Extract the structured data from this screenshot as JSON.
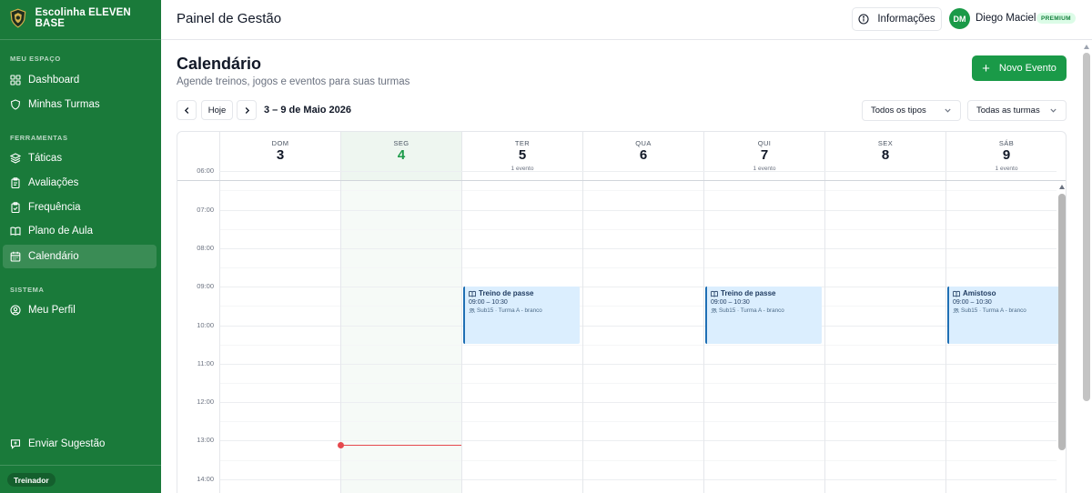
{
  "app": {
    "name": "Escolinha ELEVEN BASE"
  },
  "sidebar": {
    "sections": [
      {
        "label": "MEU ESPAÇO"
      },
      {
        "label": "FERRAMENTAS"
      },
      {
        "label": "SISTEMA"
      }
    ],
    "items": [
      {
        "label": "Dashboard",
        "icon": "grid-icon",
        "active": false
      },
      {
        "label": "Minhas Turmas",
        "icon": "shield-icon",
        "active": false
      },
      {
        "label": "Táticas",
        "icon": "layers-icon",
        "active": false
      },
      {
        "label": "Avaliações",
        "icon": "clipboard-icon",
        "active": false
      },
      {
        "label": "Frequência",
        "icon": "clipboard-check-icon",
        "active": false
      },
      {
        "label": "Plano de Aula",
        "icon": "book-icon",
        "active": false
      },
      {
        "label": "Calendário",
        "icon": "calendar-icon",
        "active": true
      },
      {
        "label": "Meu Perfil",
        "icon": "user-circle-icon",
        "active": false
      }
    ],
    "suggestion": "Enviar Sugestão",
    "role": "Treinador"
  },
  "header": {
    "title": "Painel de Gestão",
    "info_label": "Informações",
    "user": {
      "initials": "DM",
      "name": "Diego Maciel",
      "badge": "PREMIUM"
    }
  },
  "calendar": {
    "title": "Calendário",
    "subtitle": "Agende treinos, jogos e eventos para suas turmas",
    "new_event_label": "Novo Evento",
    "today_label": "Hoje",
    "range": "3 – 9 de Maio 2026",
    "filters": {
      "type": "Todos os tipos",
      "class": "Todas as turmas"
    },
    "days": [
      {
        "dow": "DOM",
        "num": "3",
        "events": "",
        "today": false
      },
      {
        "dow": "SEG",
        "num": "4",
        "events": "",
        "today": true
      },
      {
        "dow": "TER",
        "num": "5",
        "events": "1 evento",
        "today": false
      },
      {
        "dow": "QUA",
        "num": "6",
        "events": "",
        "today": false
      },
      {
        "dow": "QUI",
        "num": "7",
        "events": "1 evento",
        "today": false
      },
      {
        "dow": "SEX",
        "num": "8",
        "events": "",
        "today": false
      },
      {
        "dow": "SÁB",
        "num": "9",
        "events": "1 evento",
        "today": false
      }
    ],
    "hours": [
      "06:00",
      "07:00",
      "08:00",
      "09:00",
      "10:00",
      "11:00",
      "12:00",
      "13:00",
      "14:00"
    ],
    "now_time": "13:07",
    "events": [
      {
        "day": 2,
        "title": "Treino de passe",
        "time": "09:00 – 10:30",
        "meta": "Sub15 · Turma A - branco",
        "start": "09:00",
        "end": "10:30"
      },
      {
        "day": 4,
        "title": "Treino de passe",
        "time": "09:00 – 10:30",
        "meta": "Sub15 · Turma A - branco",
        "start": "09:00",
        "end": "10:30"
      },
      {
        "day": 6,
        "title": "Amistoso",
        "time": "09:00 – 10:30",
        "meta": "Sub15 · Turma A - branco",
        "start": "09:00",
        "end": "10:30"
      }
    ],
    "colors": {
      "brand": "#1a7a3a",
      "accent": "#1a9a48",
      "event_bg": "#dbeefe",
      "event_border": "#1f6fb4",
      "now_line": "#e5484d"
    }
  }
}
